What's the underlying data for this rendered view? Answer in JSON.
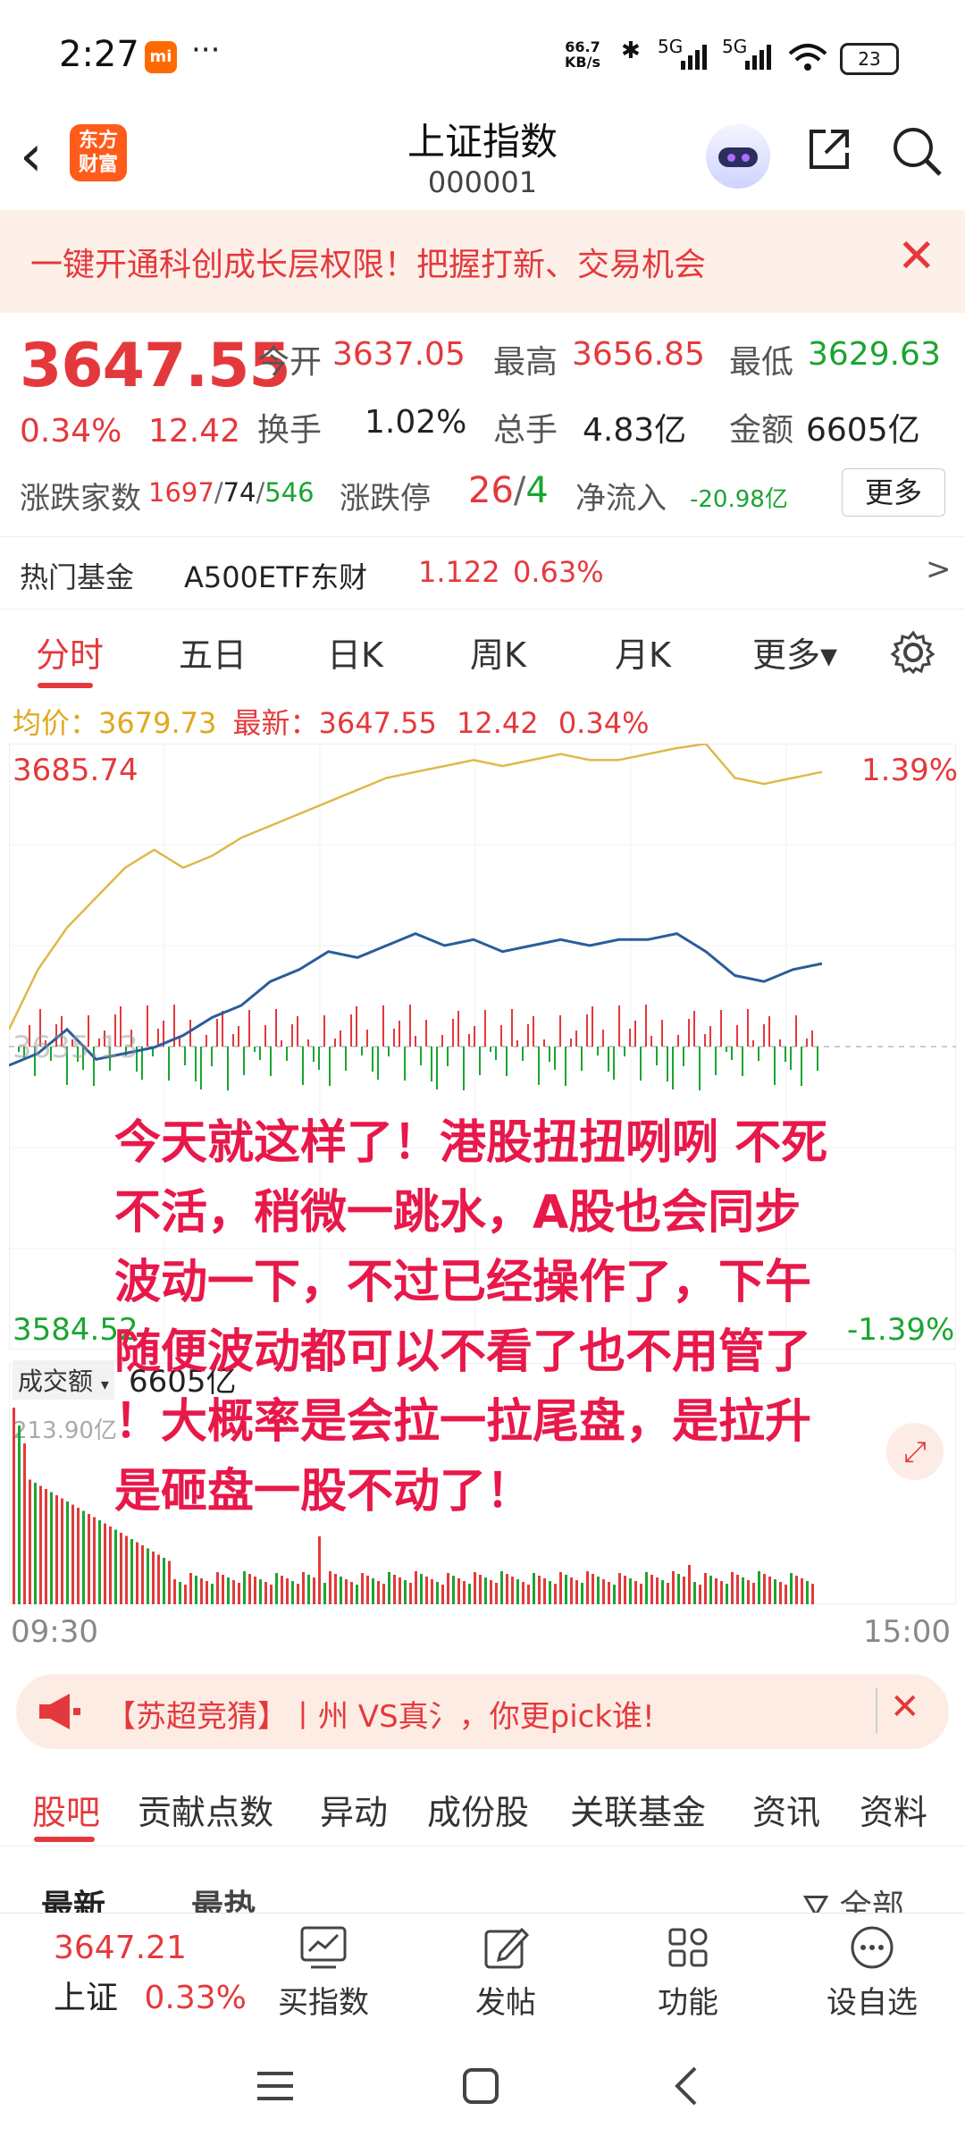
{
  "status": {
    "time": "2:27",
    "speed_top": "66.7",
    "speed_unit": "KB/s",
    "bluetooth": "✱",
    "signal1": "5G",
    "signal2": "5G",
    "battery": "23"
  },
  "header": {
    "logo_line1": "东方",
    "logo_line2": "财富",
    "title": "上证指数",
    "code": "000001"
  },
  "banner": {
    "text": "一键开通科创成长层权限！把握打新、交易机会",
    "close": "✕"
  },
  "quote": {
    "price": "3647.55",
    "pct": "0.34%",
    "change": "12.42",
    "open_label": "今开",
    "open": "3637.05",
    "high_label": "最高",
    "high": "3656.85",
    "low_label": "最低",
    "low": "3629.63",
    "turnover_label": "换手",
    "turnover": "1.02%",
    "volume_label": "总手",
    "volume": "4.83亿",
    "amount_label": "金额",
    "amount": "6605亿",
    "breadth_label": "涨跌家数",
    "breadth_up": "1697",
    "breadth_flat": "74",
    "breadth_down": "546",
    "limit_label": "涨跌停",
    "limit_up": "26",
    "limit_down": "4",
    "netflow_label": "净流入",
    "netflow": "-20.98亿",
    "more": "更多"
  },
  "fund": {
    "label": "热门基金",
    "name": "A500ETF东财",
    "price": "1.122",
    "pct": "0.63%",
    "arrow": ">"
  },
  "tabs": [
    "分时",
    "五日",
    "日K",
    "周K",
    "月K",
    "更多▾"
  ],
  "chart_info": {
    "avg_label": "均价：",
    "avg": "3679.73",
    "latest_label": "最新：",
    "latest": "3647.55",
    "change": "12.42",
    "pct": "0.34%",
    "y_top": "3685.74",
    "y_bottom": "3584.52",
    "y_mid": "3635.13",
    "pct_top": "1.39%",
    "pct_bottom": "-1.39%",
    "vol_selector": "成交额",
    "vol_total": "6605亿",
    "vol_max": "213.90亿",
    "t_start": "09:30",
    "t_end": "15:00"
  },
  "chart_data": {
    "type": "line",
    "title": "",
    "xlabel": "",
    "ylabel": "",
    "x_range": [
      "09:30",
      "15:00"
    ],
    "ylim": [
      3584.52,
      3685.74
    ],
    "series": [
      {
        "name": "",
        "color": "#e0b84a",
        "values": [
          3638,
          3648,
          3655,
          3660,
          3665,
          3668,
          3665,
          3667,
          3670,
          3672,
          3674,
          3676,
          3678,
          3680,
          3681,
          3682,
          3683,
          3682,
          3683,
          3684,
          3683,
          3683,
          3684,
          3685,
          3685.7,
          3680,
          3679,
          3680,
          3681
        ]
      },
      {
        "name": "",
        "color": "#2a5d9b",
        "values": [
          3632,
          3634,
          3638,
          3633,
          3634,
          3635,
          3637,
          3640,
          3642,
          3646,
          3648,
          3651,
          3650,
          3652,
          3654,
          3652,
          3653,
          3651,
          3652,
          3653,
          3652,
          3653,
          3653,
          3654,
          3651,
          3647,
          3646,
          3648,
          3649
        ]
      }
    ],
    "volume_series_max": 213.9
  },
  "overlay_text": [
    "今天就这样了！港股扭扭咧咧 不死",
    "不活，稍微一跳水，A股也会同步",
    "波动一下，不过已经操作了，下午",
    "随便波动都可以不看了也不用管了",
    "！大概率是会拉一拉尾盘，是拉升",
    "是砸盘一股不动了！"
  ],
  "promo": {
    "text": "【苏超竞猜】丨州 VS真氵，你更pick谁!",
    "close": "✕"
  },
  "subtabs": [
    "股吧",
    "贡献点数",
    "异动",
    "成份股",
    "关联基金",
    "资讯",
    "资料"
  ],
  "feed": {
    "sort_latest": "最新",
    "sort_hot": "最热",
    "filter": "全部"
  },
  "toolbar": {
    "index_price": "3647.21",
    "index_name": "上证",
    "index_pct": "0.33%",
    "buy": "买指数",
    "post": "发帖",
    "func": "功能",
    "watch": "设自选"
  }
}
